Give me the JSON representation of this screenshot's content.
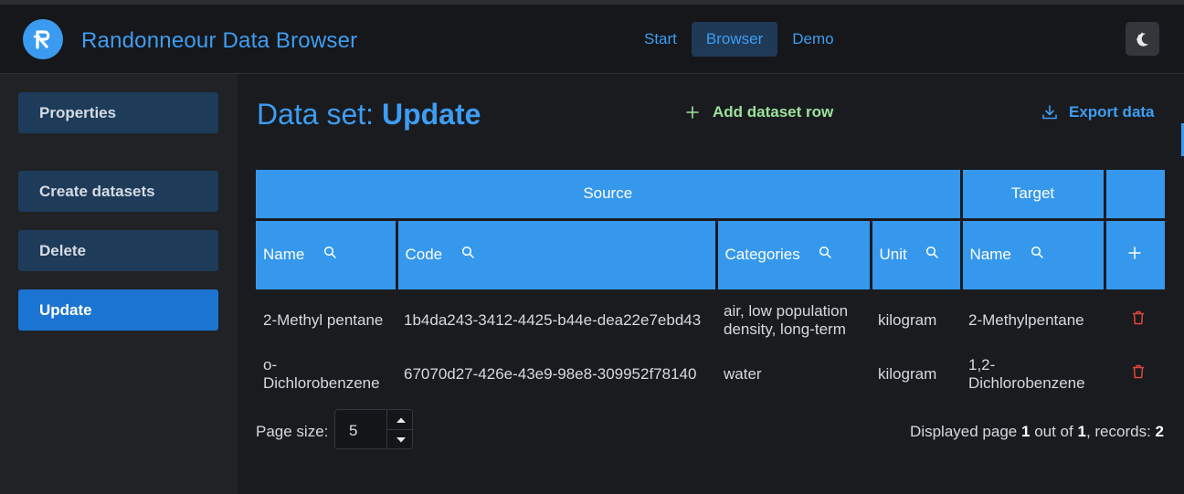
{
  "app": {
    "title": "Randonneour Data Browser"
  },
  "nav": [
    {
      "label": "Start"
    },
    {
      "label": "Browser",
      "active": true
    },
    {
      "label": "Demo"
    }
  ],
  "sidebar": {
    "items": [
      {
        "label": "Properties"
      },
      {
        "label": "Create datasets"
      },
      {
        "label": "Delete"
      },
      {
        "label": "Update",
        "active": true
      }
    ]
  },
  "main": {
    "title_prefix": "Data set:",
    "title_name": "Update",
    "add_label": "Add dataset row",
    "export_label": "Export data"
  },
  "table": {
    "groups": {
      "source": "Source",
      "target": "Target"
    },
    "columns": {
      "source_name": "Name",
      "source_code": "Code",
      "categories": "Categories",
      "unit": "Unit",
      "target_name": "Name"
    },
    "rows": [
      {
        "source_name": "2-Methyl pentane",
        "code": "1b4da243-3412-4425-b44e-dea22e7ebd43",
        "categories": "air, low population density, long-term",
        "unit": "kilogram",
        "target_name": "2-Methylpentane"
      },
      {
        "source_name": "o-Dichlorobenzene",
        "code": "67070d27-426e-43e9-98e8-309952f78140",
        "categories": "water",
        "unit": "kilogram",
        "target_name": "1,2-Dichlorobenzene"
      }
    ]
  },
  "pager": {
    "page_size_label": "Page size:",
    "page_size": "5",
    "info_prefix": "Displayed page",
    "page": "1",
    "info_mid": "out of",
    "total_pages": "1",
    "info_records": ", records:",
    "records": "2"
  },
  "colors": {
    "accent": "#3d9df2",
    "header_cell": "#3598ec",
    "add_action": "#9be39b",
    "delete_icon": "#e0443e",
    "sidebar_active": "#1b74d1"
  },
  "icons": {
    "logo": "logo-icon",
    "theme": "theme-toggle-icon",
    "add": "plus-icon",
    "export": "download-icon",
    "search": "search-icon",
    "delete": "trash-icon",
    "stepper_up": "chevron-up-icon",
    "stepper_down": "chevron-down-icon"
  }
}
